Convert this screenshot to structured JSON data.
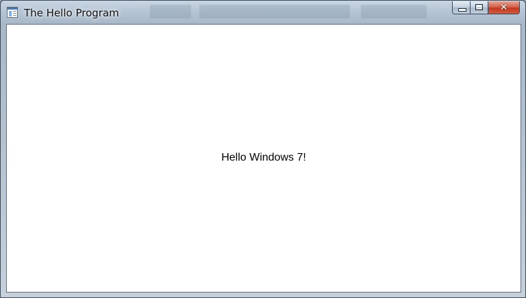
{
  "window": {
    "title": "The Hello Program",
    "icon": "application-window-icon",
    "caption_buttons": {
      "minimize_icon": "minimize-icon",
      "maximize_icon": "maximize-icon",
      "close_icon": "close-icon",
      "close_glyph": "✕"
    }
  },
  "client": {
    "message": "Hello Windows 7!"
  },
  "colors": {
    "client_background": "#ffffff",
    "close_button": "#c2391f",
    "frame": "#b7c6d6"
  }
}
